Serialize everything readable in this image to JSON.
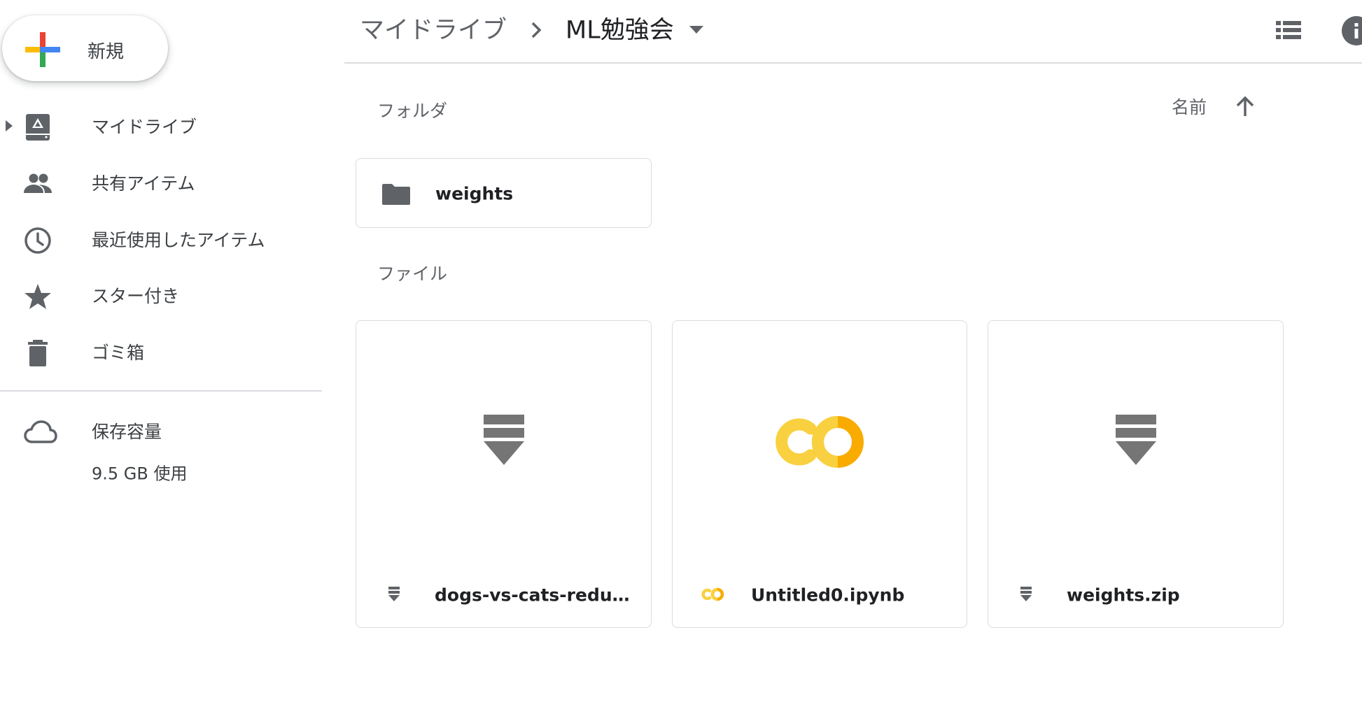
{
  "sidebar": {
    "new_button_label": "新規",
    "items": [
      {
        "label": "マイドライブ",
        "icon": "my-drive-icon"
      },
      {
        "label": "共有アイテム",
        "icon": "people-icon"
      },
      {
        "label": "最近使用したアイテム",
        "icon": "clock-icon"
      },
      {
        "label": "スター付き",
        "icon": "star-icon"
      },
      {
        "label": "ゴミ箱",
        "icon": "trash-icon"
      }
    ],
    "storage": {
      "label": "保存容量",
      "usage": "9.5 GB 使用",
      "icon": "cloud-icon"
    }
  },
  "header": {
    "breadcrumb_root": "マイドライブ",
    "breadcrumb_separator_icon": "chevron-right-icon",
    "current_folder": "ML勉強会",
    "caret_icon": "dropdown-caret-icon",
    "list_view_icon": "list-view-icon",
    "info_icon": "info-icon"
  },
  "main": {
    "folders_title": "フォルダ",
    "sort_label": "名前",
    "sort_direction_icon": "arrow-up-icon",
    "folders": [
      {
        "name": "weights",
        "icon": "folder-icon"
      }
    ],
    "files_title": "ファイル",
    "files": [
      {
        "name": "dogs-vs-cats-redux-ke...",
        "type": "archive",
        "icon": "archive-icon"
      },
      {
        "name": "Untitled0.ipynb",
        "type": "colab",
        "icon": "colab-icon"
      },
      {
        "name": "weights.zip",
        "type": "archive",
        "icon": "archive-icon"
      }
    ]
  },
  "colors": {
    "icon_gray": "#5f6368",
    "text_dark": "#202124",
    "text_medium": "#3c4043",
    "border": "#dadce0",
    "colab_yellow_light": "#F9D03F",
    "colab_yellow_dark": "#F9AB00",
    "plus_blue": "#4285F4",
    "plus_red": "#EA4335",
    "plus_yellow": "#FBBC04",
    "plus_green": "#34A853"
  }
}
